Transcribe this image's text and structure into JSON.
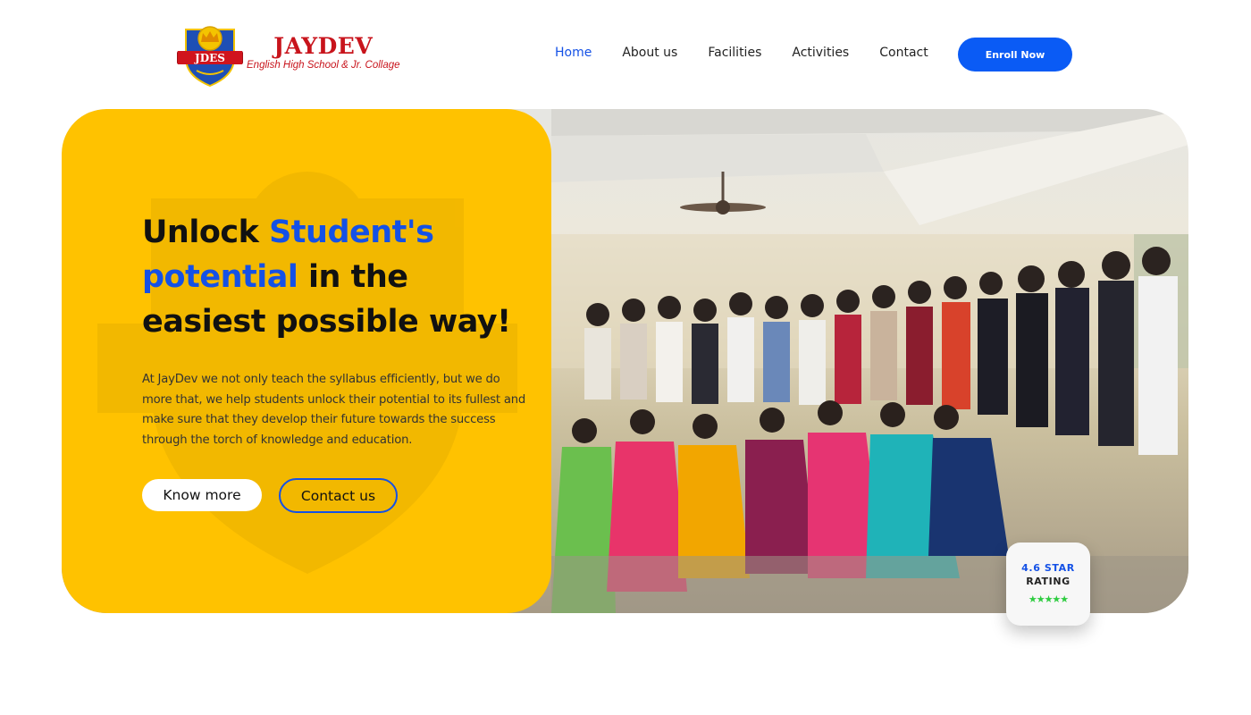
{
  "header": {
    "logo_emblem_text": "JDES",
    "brand_name": "JAYDEV",
    "brand_subtitle": "English High School & Jr. Collage",
    "nav": [
      {
        "label": "Home",
        "active": true
      },
      {
        "label": "About us",
        "active": false
      },
      {
        "label": "Facilities",
        "active": false
      },
      {
        "label": "Activities",
        "active": false
      },
      {
        "label": "Contact",
        "active": false
      }
    ],
    "enroll_label": "Enroll Now"
  },
  "hero": {
    "headline_part1": "Unlock ",
    "headline_highlight1": "Student's potential",
    "headline_part2": " in the easiest possible way!",
    "description": "At JayDev we not only teach the syllabus efficiently, but we do more that, we help students unlock their potential to its fullest and make sure that they develop their future towards the success through the torch of knowledge and education.",
    "primary_button": "Know more",
    "secondary_button": "Contact us",
    "photo_description_icon": "group-photo"
  },
  "rating": {
    "value_line": "4.6 STAR",
    "label_line": "RATING",
    "stars": "★★★★★",
    "star_count": 5
  },
  "colors": {
    "accent_blue": "#1451e6",
    "button_blue": "#0a5bf5",
    "panel_yellow": "#ffc200",
    "brand_red": "#c8141c",
    "star_green": "#2ecc40"
  }
}
